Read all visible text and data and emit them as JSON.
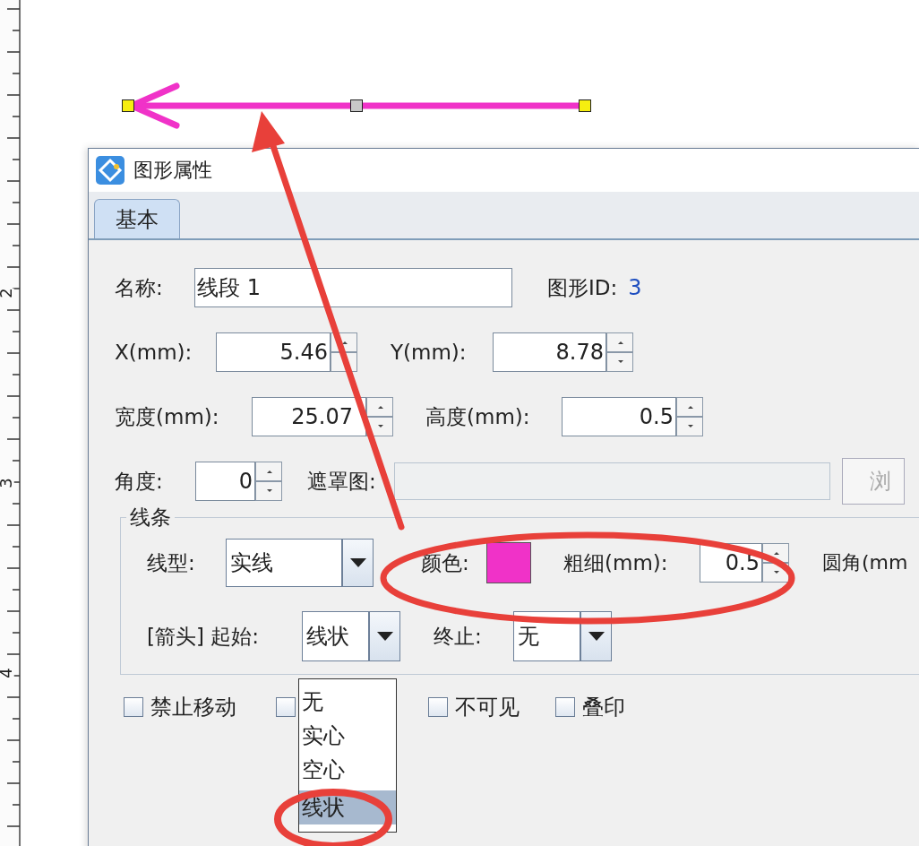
{
  "ruler": {
    "labels": [
      "2",
      "3",
      "4"
    ]
  },
  "window": {
    "title": "图形属性"
  },
  "tabs": [
    {
      "label": "基本",
      "selected": true
    }
  ],
  "name": {
    "label": "名称:",
    "value": "线段 1"
  },
  "shape_id": {
    "label": "图形ID:",
    "value": "3"
  },
  "x": {
    "label": "X(mm):",
    "value": "5.46"
  },
  "y": {
    "label": "Y(mm):",
    "value": "8.78"
  },
  "width": {
    "label": "宽度(mm):",
    "value": "25.07"
  },
  "height": {
    "label": "高度(mm):",
    "value": "0.5"
  },
  "angle": {
    "label": "角度:",
    "value": "0"
  },
  "mask": {
    "label": "遮罩图:",
    "disabled": true,
    "button": "浏"
  },
  "line_group": {
    "title": "线条",
    "line_type": {
      "label": "线型:",
      "value": "实线"
    },
    "color": {
      "label": "颜色:",
      "color": "#f032c8"
    },
    "thickness": {
      "label": "粗细(mm):",
      "value": "0.5"
    },
    "corner": {
      "label": "圆角(mm"
    },
    "arrow_start": {
      "label": "[箭头] 起始:",
      "value": "线状",
      "expanded": true,
      "options": [
        {
          "label": "无",
          "selected": false
        },
        {
          "label": "实心",
          "selected": false
        },
        {
          "label": "空心",
          "selected": false
        },
        {
          "label": "线状",
          "selected": true
        }
      ]
    },
    "arrow_end": {
      "label": "终止:",
      "value": "无"
    }
  },
  "checkboxes": [
    {
      "label": "禁止移动",
      "checked": false
    },
    {
      "checked": false
    },
    {
      "label": "不可见",
      "checked": false
    },
    {
      "label": "叠印",
      "checked": false
    }
  ]
}
